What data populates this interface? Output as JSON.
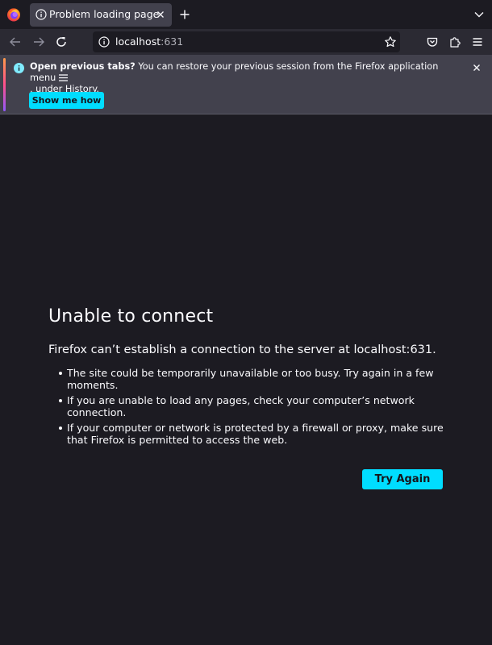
{
  "browser": {
    "name": "Firefox",
    "tab": {
      "title": "Problem loading page"
    },
    "urlbar": {
      "host": "localhost",
      "port": ":631"
    }
  },
  "icons": {
    "app_logo": "firefox-logo",
    "tab_info": "info-icon",
    "tab_close": "close-icon",
    "new_tab": "plus-icon",
    "tab_list": "chevron-down-icon",
    "back": "arrow-left-icon",
    "forward": "arrow-right-icon",
    "reload": "reload-icon",
    "bookmark": "star-icon",
    "pocket": "pocket-icon",
    "extensions": "puzzle-icon",
    "menu": "hamburger-icon"
  },
  "notification": {
    "title": "Open previous tabs?",
    "message_before_icon": "You can restore your previous session from the Firefox application menu",
    "message_after_icon": ", under History.",
    "button_label": "Show me how",
    "close_glyph": "×"
  },
  "error": {
    "title": "Unable to connect",
    "description": "Firefox can’t establish a connection to the server at localhost:631.",
    "reasons": [
      "The site could be temporarily unavailable or too busy. Try again in a few moments.",
      "If you are unable to load any pages, check your computer’s network connection.",
      "If your computer or network is protected by a firewall or proxy, make sure that Firefox is permitted to access the web."
    ],
    "try_again_label": "Try Again"
  },
  "colors": {
    "page_bg": "#1c1b22",
    "toolbar_bg": "#2b2a33",
    "selected_tab_bg": "#42414d",
    "accent": "#00ddff"
  }
}
